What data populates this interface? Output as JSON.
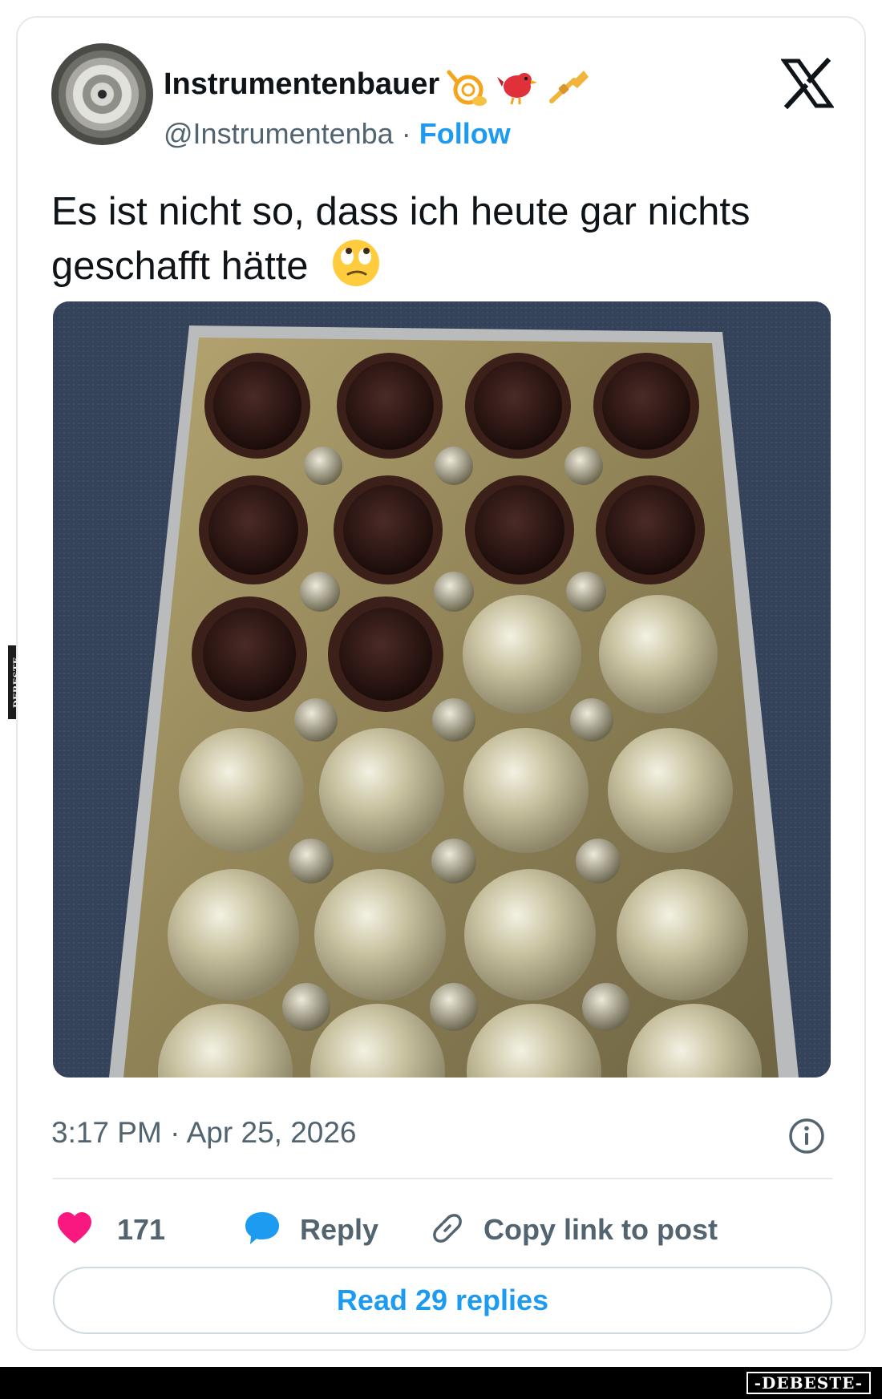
{
  "side_watermark": "DEBESTE",
  "author": {
    "display_name": "Instrumentenbauer",
    "name_emojis": [
      "french-horn-icon",
      "bird-icon",
      "trumpet-icon"
    ],
    "handle": "@Instrumentenba",
    "separator": "·",
    "follow_label": "Follow"
  },
  "brand_icon": "x-logo-icon",
  "tweet": {
    "text": "Es ist nicht so, dass ich heute gar nichts geschafft hätte",
    "emoji": "face-with-rolling-eyes-icon"
  },
  "photo": {
    "description_icon": "chocolate-box-photo",
    "rows": 6,
    "cols": 4,
    "filled_count": 10
  },
  "meta": {
    "timestamp": "3:17 PM · Apr 25, 2026"
  },
  "actions": {
    "likes": "171",
    "reply_label": "Reply",
    "copy_label": "Copy link to post"
  },
  "read_replies_label": "Read 29 replies",
  "bottom_watermark": "-DEBESTE-",
  "colors": {
    "accent": "#1d9bf0",
    "heart": "#f91880",
    "muted": "#536471",
    "text": "#0f1419"
  }
}
